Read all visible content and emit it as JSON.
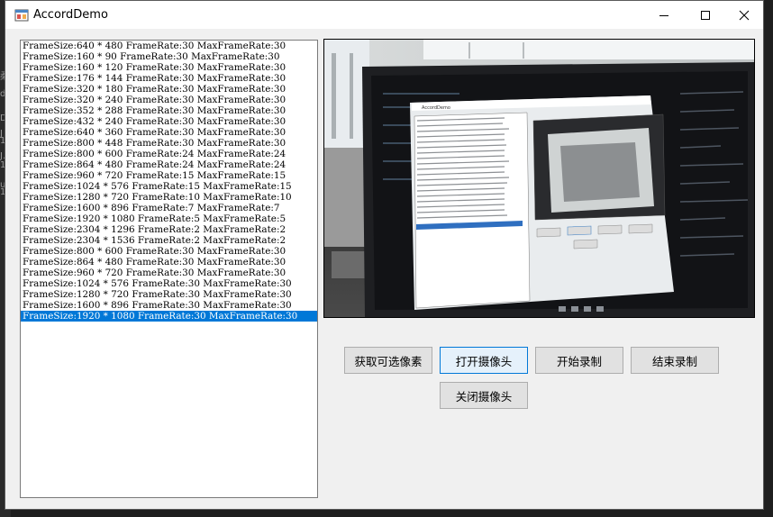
{
  "window": {
    "title": "AccordDemo"
  },
  "background_glyphs": [
    "柔",
    "d",
    "D",
    "J",
    "1.",
    "J.",
    "1.",
    "u.",
    "1."
  ],
  "resolutions": [
    "FrameSize:640 * 480 FrameRate:30 MaxFrameRate:30",
    "FrameSize:160 * 90 FrameRate:30 MaxFrameRate:30",
    "FrameSize:160 * 120 FrameRate:30 MaxFrameRate:30",
    "FrameSize:176 * 144 FrameRate:30 MaxFrameRate:30",
    "FrameSize:320 * 180 FrameRate:30 MaxFrameRate:30",
    "FrameSize:320 * 240 FrameRate:30 MaxFrameRate:30",
    "FrameSize:352 * 288 FrameRate:30 MaxFrameRate:30",
    "FrameSize:432 * 240 FrameRate:30 MaxFrameRate:30",
    "FrameSize:640 * 360 FrameRate:30 MaxFrameRate:30",
    "FrameSize:800 * 448 FrameRate:30 MaxFrameRate:30",
    "FrameSize:800 * 600 FrameRate:24 MaxFrameRate:24",
    "FrameSize:864 * 480 FrameRate:24 MaxFrameRate:24",
    "FrameSize:960 * 720 FrameRate:15 MaxFrameRate:15",
    "FrameSize:1024 * 576 FrameRate:15 MaxFrameRate:15",
    "FrameSize:1280 * 720 FrameRate:10 MaxFrameRate:10",
    "FrameSize:1600 * 896 FrameRate:7 MaxFrameRate:7",
    "FrameSize:1920 * 1080 FrameRate:5 MaxFrameRate:5",
    "FrameSize:2304 * 1296 FrameRate:2 MaxFrameRate:2",
    "FrameSize:2304 * 1536 FrameRate:2 MaxFrameRate:2",
    "FrameSize:800 * 600 FrameRate:30 MaxFrameRate:30",
    "FrameSize:864 * 480 FrameRate:30 MaxFrameRate:30",
    "FrameSize:960 * 720 FrameRate:30 MaxFrameRate:30",
    "FrameSize:1024 * 576 FrameRate:30 MaxFrameRate:30",
    "FrameSize:1280 * 720 FrameRate:30 MaxFrameRate:30",
    "FrameSize:1600 * 896 FrameRate:30 MaxFrameRate:30",
    "FrameSize:1920 * 1080 FrameRate:30 MaxFrameRate:30"
  ],
  "selected_index": 25,
  "buttons": {
    "get_resolutions": "获取可选像素",
    "open_camera": "打开摄像头",
    "start_record": "开始录制",
    "stop_record": "结束录制",
    "close_camera": "关闭摄像头"
  },
  "colors": {
    "selection": "#0078d7",
    "window_bg": "#f0f0f0",
    "focus_border": "#0078d7"
  }
}
